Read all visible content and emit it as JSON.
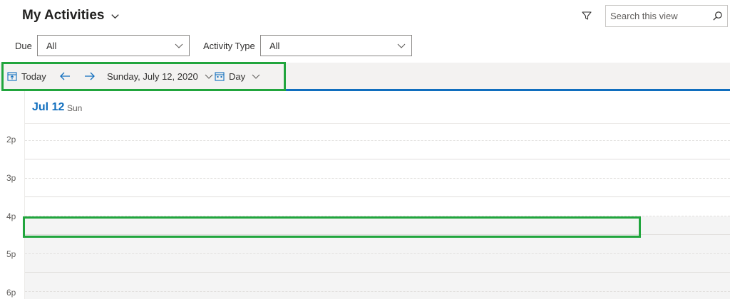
{
  "header": {
    "title": "My Activities",
    "search_placeholder": "Search this view"
  },
  "filters": {
    "due_label": "Due",
    "due_value": "All",
    "activity_type_label": "Activity Type",
    "activity_type_value": "All"
  },
  "toolbar": {
    "today_label": "Today",
    "date_label": "Sunday, July 12, 2020",
    "view_label": "Day"
  },
  "calendar": {
    "date": "Jul 12",
    "weekday": "Sun",
    "time_labels": [
      "2p",
      "3p",
      "4p",
      "5p",
      "6p"
    ]
  },
  "colors": {
    "accent": "#106ebe",
    "highlight": "#21a53d",
    "toolbar_bg": "#f3f2f1",
    "after_hours_bg": "#f4f4f4"
  },
  "icons": [
    "chevron-down-icon",
    "filter-icon",
    "search-icon",
    "calendar-today-icon",
    "arrow-left-icon",
    "arrow-right-icon",
    "calendar-view-icon"
  ]
}
